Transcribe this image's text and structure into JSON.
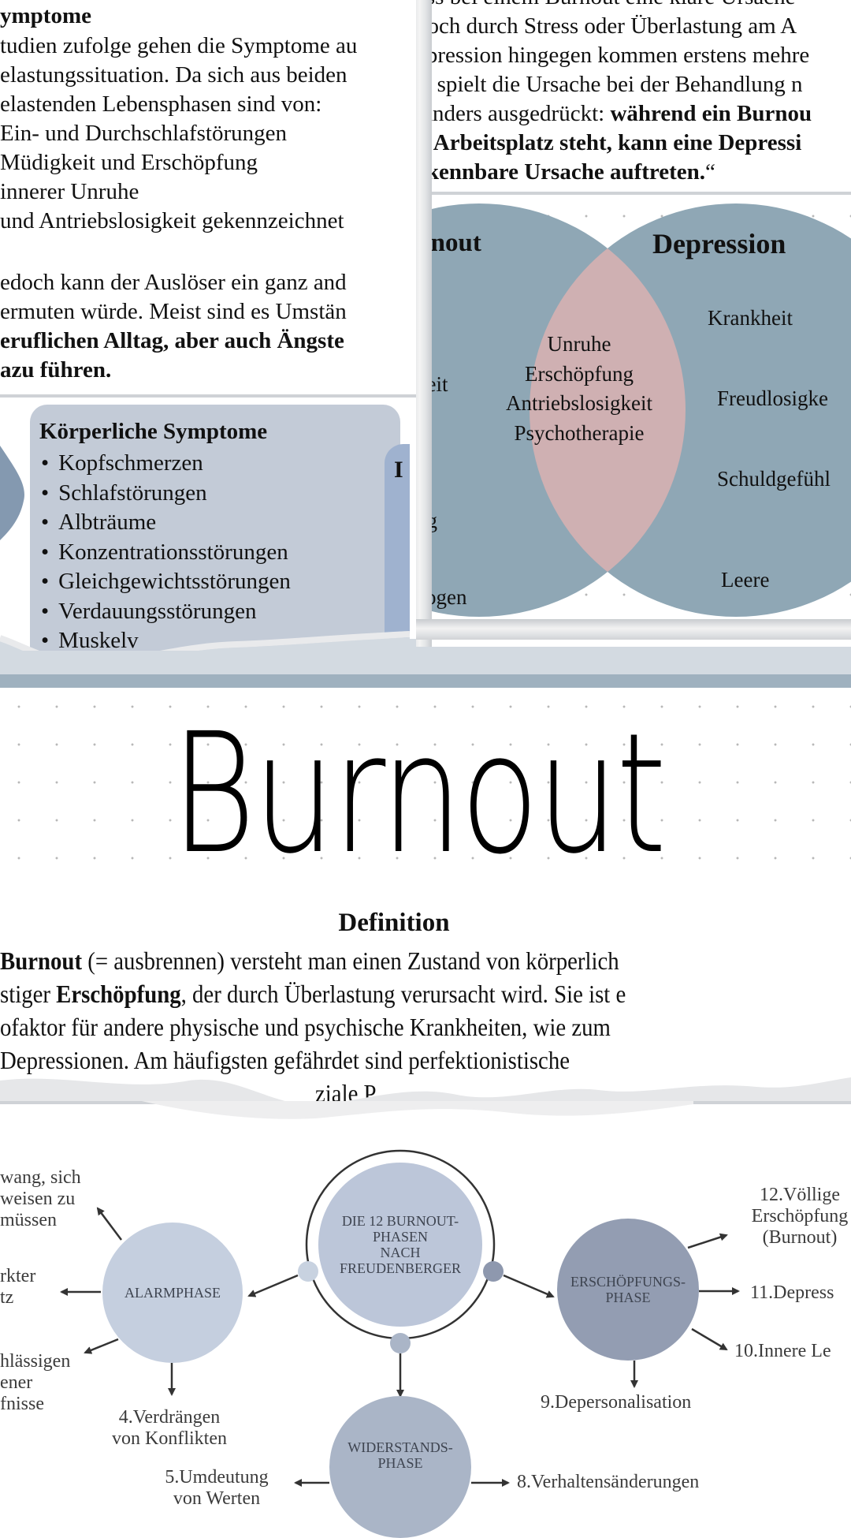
{
  "symptoms_section": {
    "heading": "ymptome",
    "lines": [
      "tudien zufolge gehen die Symptome au",
      "elastungssituation. Da sich aus beiden",
      "elastenden Lebensphasen sind von:",
      " Ein- und Durchschlafstörungen",
      " Müdigkeit und Erschöpfung",
      "innerer Unruhe",
      "und Antriebslosigkeit gekennzeichnet"
    ],
    "para2_lines": [
      "edoch kann der Auslöser ein ganz and",
      "ermuten würde. Meist sind es Umstän"
    ],
    "para2_bold_lines": [
      "eruflichen Alltag, aber auch Ängste",
      "azu führen."
    ]
  },
  "symptom_card": {
    "title": "Körperliche Symptome",
    "items": [
      "Kopfschmerzen",
      "Schlafstörungen",
      "Albträume",
      "Konzentrationsstörungen",
      "Gleichgewichtsstörungen",
      "Verdauungsstörungen",
      "Muskelv"
    ],
    "second_card_initial": "I"
  },
  "comparison_text": {
    "lines": [
      "ass bei einem Burnout eine klare Ursache",
      " doch durch Stress oder Überlastung am A",
      "epression hingegen kommen erstens mehre",
      "ıs spielt die Ursache bei der Behandlung n"
    ],
    "line5_normal": " Anders ausgedrückt: ",
    "line5_bold": "während ein Burnou",
    "bold_lines": [
      "n Arbeitsplatz steht, kann eine Depressi",
      "rkennbare Ursache auftreten."
    ],
    "closing_quote": "“"
  },
  "venn": {
    "left_title": "rnout",
    "right_title": "Depression",
    "left_items": [
      "keit",
      "ng",
      "zogen"
    ],
    "overlap_items": [
      "Unruhe",
      "Erschöpfung",
      "Antriebslosigkeit",
      "Psychotherapie"
    ],
    "right_items": [
      "Krankheit",
      "Freudlosigke",
      "Schuldgefühl",
      "Leere"
    ],
    "colors": {
      "circle": "#8fa7b5",
      "overlap": "#cfb0b2"
    }
  },
  "title": "Burnout",
  "definition": {
    "heading": "Definition",
    "line1_bold": "Burnout",
    "line1_rest": " (= ausbrennen) versteht man einen Zustand von körperlich",
    "line2_start": "stiger ",
    "line2_bold": "Erschöpfung",
    "line2_rest": ", der durch Überlastung verursacht wird. Sie ist e",
    "line3": "ofaktor für andere physische und psychische Krankheiten, wie zum",
    "line4": "   Depressionen. Am häufigsten gefährdet sind perfektionistische",
    "line5_fragment": "ziale  P"
  },
  "phases_diagram": {
    "center": "DIE 12 BURNOUT-\nPHASEN\nNACH\nFREUDENBERGER",
    "alarm": "ALARMPHASE",
    "resistance": "WIDERSTANDS-\nPHASE",
    "exhaustion": "ERSCHÖPFUNGS-\nPHASE",
    "alarm_outputs": [
      "wang, sich\nweisen zu\nmüssen",
      "rkter\ntz",
      "hlässigen\nener\nfnisse",
      "4.Verdrängen\nvon Konflikten"
    ],
    "resistance_outputs": [
      "5.Umdeutung\nvon Werten",
      "8.Verhaltensänderungen"
    ],
    "exhaustion_outputs": [
      "12.Völlige\nErschöpfung\n(Burnout)",
      "11.Depress",
      "10.Innere Le",
      "9.Depersonalisation"
    ],
    "colors": {
      "center": "#bcc6d9",
      "alarm": "#c5cfdf",
      "resistance": "#aab5c7",
      "exhaustion": "#939db2"
    }
  }
}
